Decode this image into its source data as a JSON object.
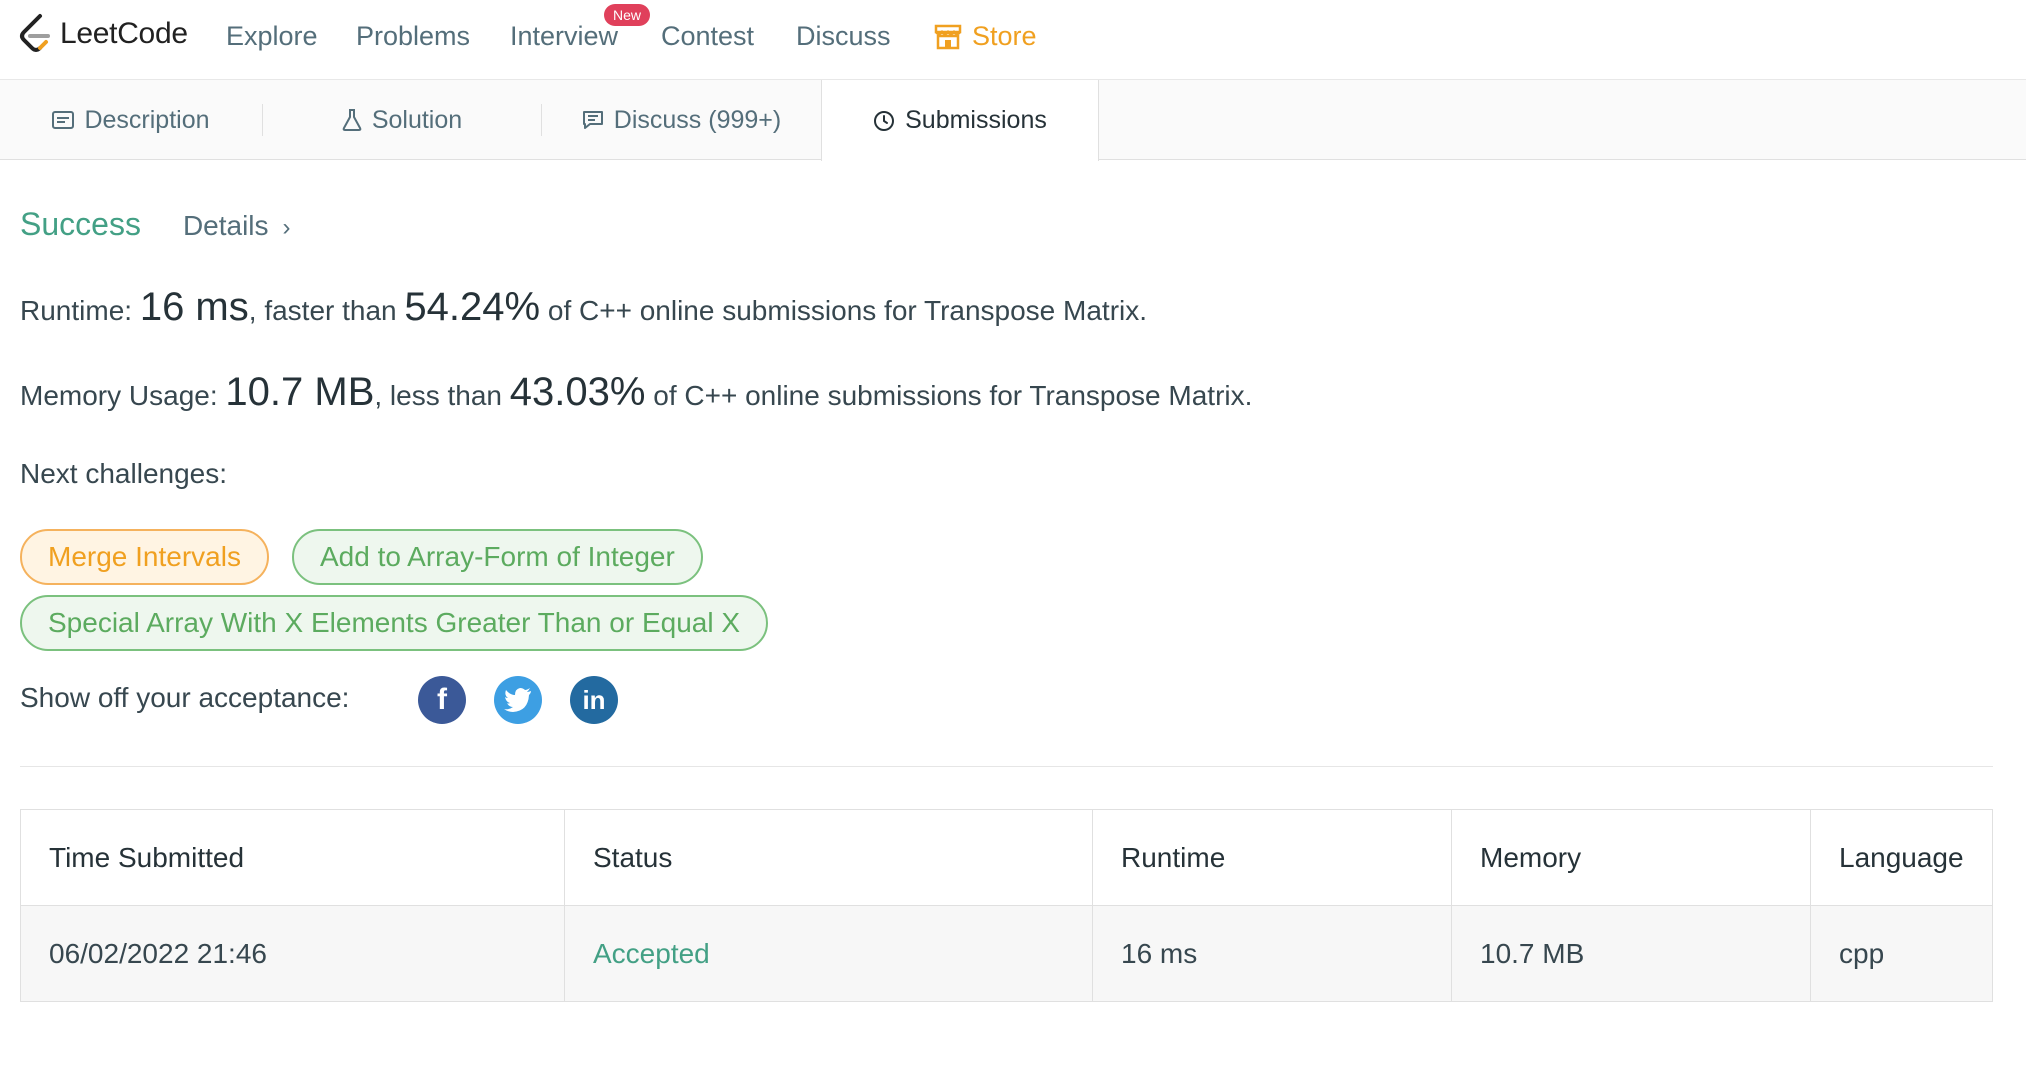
{
  "nav": {
    "logo_text": "LeetCode",
    "links": [
      "Explore",
      "Problems",
      "Interview",
      "Contest",
      "Discuss"
    ],
    "badge": "New",
    "store": "Store",
    "colors": {
      "store": "#f0a020",
      "badge": "#e0405b"
    }
  },
  "tabs": [
    {
      "label": "Description",
      "icon": "description-icon"
    },
    {
      "label": "Solution",
      "icon": "flask-icon"
    },
    {
      "label": "Discuss (999+)",
      "icon": "comment-icon"
    },
    {
      "label": "Submissions",
      "icon": "clock-icon",
      "active": true
    }
  ],
  "result": {
    "status": "Success",
    "details": "Details",
    "runtime_label": "Runtime:",
    "runtime_value": "16 ms",
    "runtime_mid": ", faster than",
    "runtime_pct": "54.24%",
    "runtime_tail": "of C++ online submissions for Transpose Matrix.",
    "memory_label": "Memory Usage:",
    "memory_value": "10.7 MB",
    "memory_mid": ", less than",
    "memory_pct": "43.03%",
    "memory_tail": "of C++ online submissions for Transpose Matrix.",
    "colors": {
      "success": "#43a085"
    }
  },
  "next": {
    "label": "Next challenges:",
    "challenges": [
      "Merge Intervals",
      "Add to Array-Form of Integer",
      "Special Array With X Elements Greater Than or Equal X"
    ]
  },
  "share": {
    "label": "Show off your acceptance:",
    "icons": [
      "facebook-icon",
      "twitter-icon",
      "linkedin-icon"
    ]
  },
  "table": {
    "headers": [
      "Time Submitted",
      "Status",
      "Runtime",
      "Memory",
      "Language"
    ],
    "rows": [
      [
        "06/02/2022 21:46",
        "Accepted",
        "16 ms",
        "10.7 MB",
        "cpp"
      ]
    ]
  }
}
